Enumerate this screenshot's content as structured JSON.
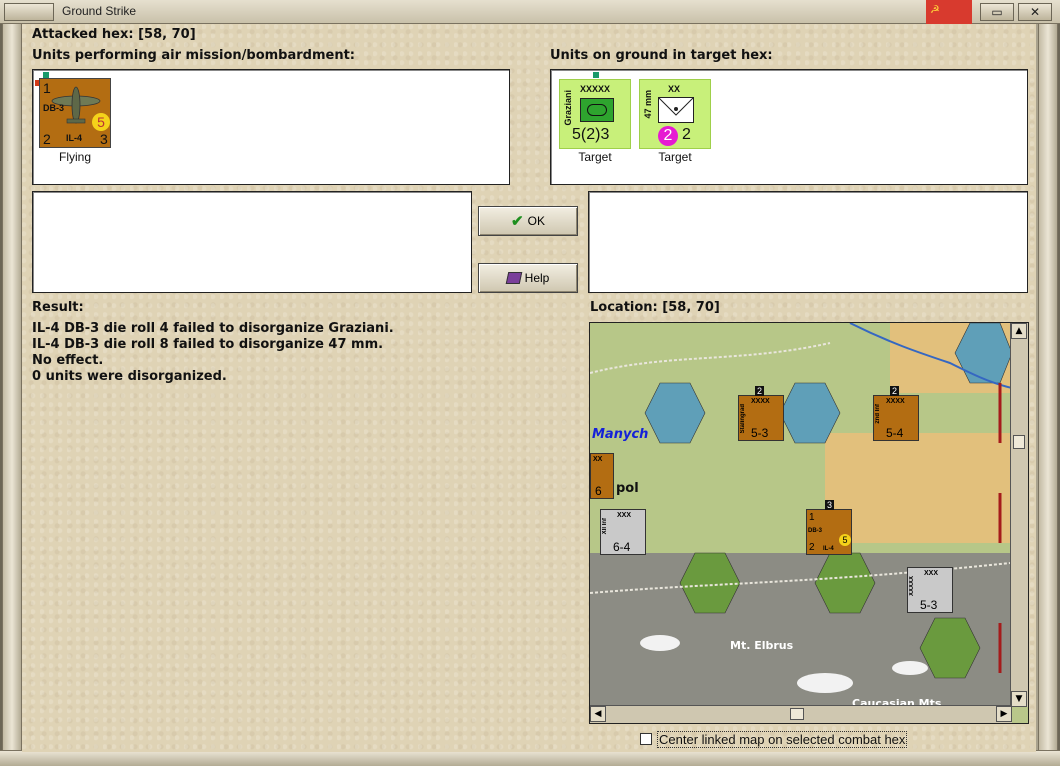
{
  "window": {
    "title": "Ground Strike",
    "flag_symbol": "☭",
    "restore_glyph": "▭",
    "close_glyph": "✕"
  },
  "attacked_hex": {
    "label": "Attacked hex:",
    "value": "[58, 70]"
  },
  "air_units": {
    "label": "Units performing air mission/bombardment:",
    "items": [
      {
        "top_left": "1",
        "type": "DB-3",
        "name": "IL-4",
        "left": "2",
        "right": "3",
        "badge": "5",
        "status": "Flying"
      }
    ]
  },
  "ground_units": {
    "label": "Units on ground in target hex:",
    "items": [
      {
        "name": "Graziani",
        "size": "XXXXX",
        "strength": "5(2)3",
        "status": "Target"
      },
      {
        "name": "47 mm",
        "size": "XX",
        "strength_badge": "2",
        "strength": "2",
        "status": "Target"
      }
    ]
  },
  "buttons": {
    "ok": "OK",
    "help": "Help"
  },
  "result": {
    "label": "Result:",
    "lines": [
      "IL-4 DB-3 die roll 4 failed to disorganize Graziani.",
      "IL-4 DB-3 die roll 8 failed to disorganize 47 mm.",
      "No effect.",
      "0 units were disorganized."
    ]
  },
  "location": {
    "label": "Location:",
    "value": "[58, 70]"
  },
  "map": {
    "labels": [
      "Manych",
      "pol",
      "Mt. Elbrus",
      "Caucasian Mts"
    ],
    "counters": [
      {
        "stack": "2",
        "size": "XXXX",
        "side": "Stalingrad",
        "strength": "5-3"
      },
      {
        "stack": "2",
        "size": "XXXX",
        "side": "2nd Inf",
        "strength": "5-4"
      },
      {
        "size": "XX",
        "strength": "6"
      },
      {
        "size": "XXX",
        "side": "XII Inf",
        "strength": "6-4"
      },
      {
        "stack": "3",
        "top_left": "1",
        "type": "DB-3",
        "name": "IL-4",
        "left": "2",
        "badge": "5"
      },
      {
        "size": "XXX",
        "side": "XXXXX",
        "strength": "5-3"
      }
    ]
  },
  "scroll": {
    "up": "▲",
    "down": "▼",
    "left": "◀",
    "right": "▶"
  },
  "center_option": {
    "label": "Center linked map on selected combat hex",
    "checked": false
  }
}
